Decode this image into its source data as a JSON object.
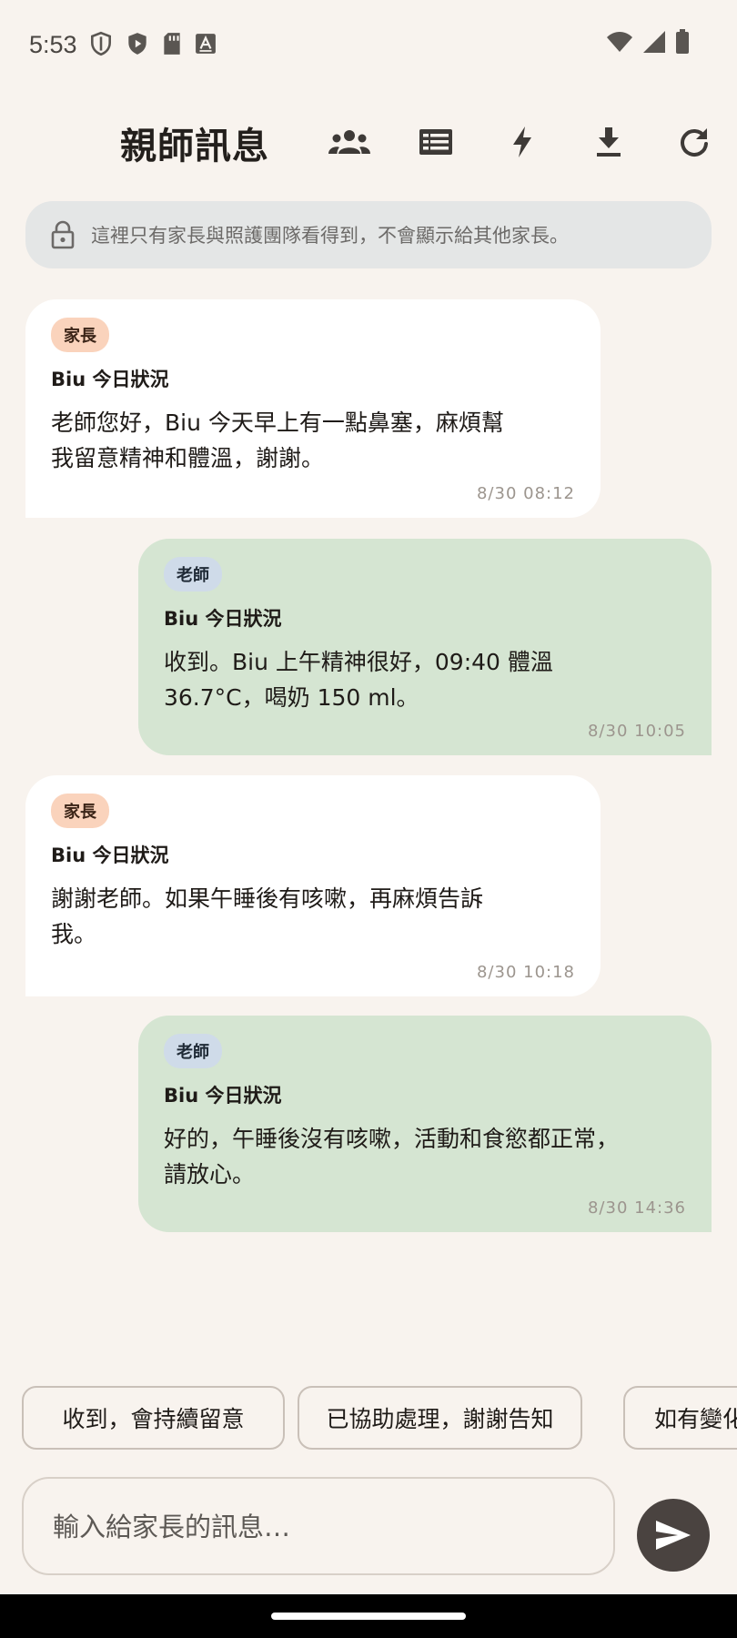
{
  "status_bar": {
    "time": "5:53"
  },
  "header": {
    "title": "親師訊息"
  },
  "privacy_notice": "這裡只有家長與照護團隊看得到，不會顯示給其他家長。",
  "messages": [
    {
      "role": "家長",
      "title": "Biu 今日狀況",
      "line1": "老師您好，Biu 今天早上有一點鼻塞，麻煩幫",
      "line2": "我留意精神和體溫，謝謝。",
      "time": "8/30 08:12"
    },
    {
      "role": "老師",
      "title": "Biu 今日狀況",
      "line1": "收到。Biu 上午精神很好，09:40 體溫",
      "line2": "36.7°C，喝奶 150 ml。",
      "time": "8/30 10:05"
    },
    {
      "role": "家長",
      "title": "Biu 今日狀況",
      "line1": "謝謝老師。如果午睡後有咳嗽，再麻煩告訴",
      "line2": "我。",
      "time": "8/30 10:18"
    },
    {
      "role": "老師",
      "title": "Biu 今日狀況",
      "line1": "好的，午睡後沒有咳嗽，活動和食慾都正常，",
      "line2": "請放心。",
      "time": "8/30 14:36"
    }
  ],
  "quick_replies": [
    "收到，會持續留意",
    "已協助處理，謝謝告知",
    "如有變化"
  ],
  "composer": {
    "placeholder": "輸入給家長的訊息…"
  },
  "colors": {
    "parent_bubble": "#ffffff",
    "teacher_bubble": "#d5e5d2",
    "parent_badge": "#fad3bc",
    "teacher_badge": "#cfdbe9",
    "send_button": "#4a4340"
  },
  "icons": [
    "shield-outline-icon",
    "shield-play-icon",
    "sd-card-icon",
    "text-a-icon",
    "wifi-icon",
    "signal-icon",
    "battery-icon",
    "group-icon",
    "list-icon",
    "bolt-icon",
    "download-icon",
    "refresh-icon",
    "lock-icon",
    "send-icon"
  ]
}
